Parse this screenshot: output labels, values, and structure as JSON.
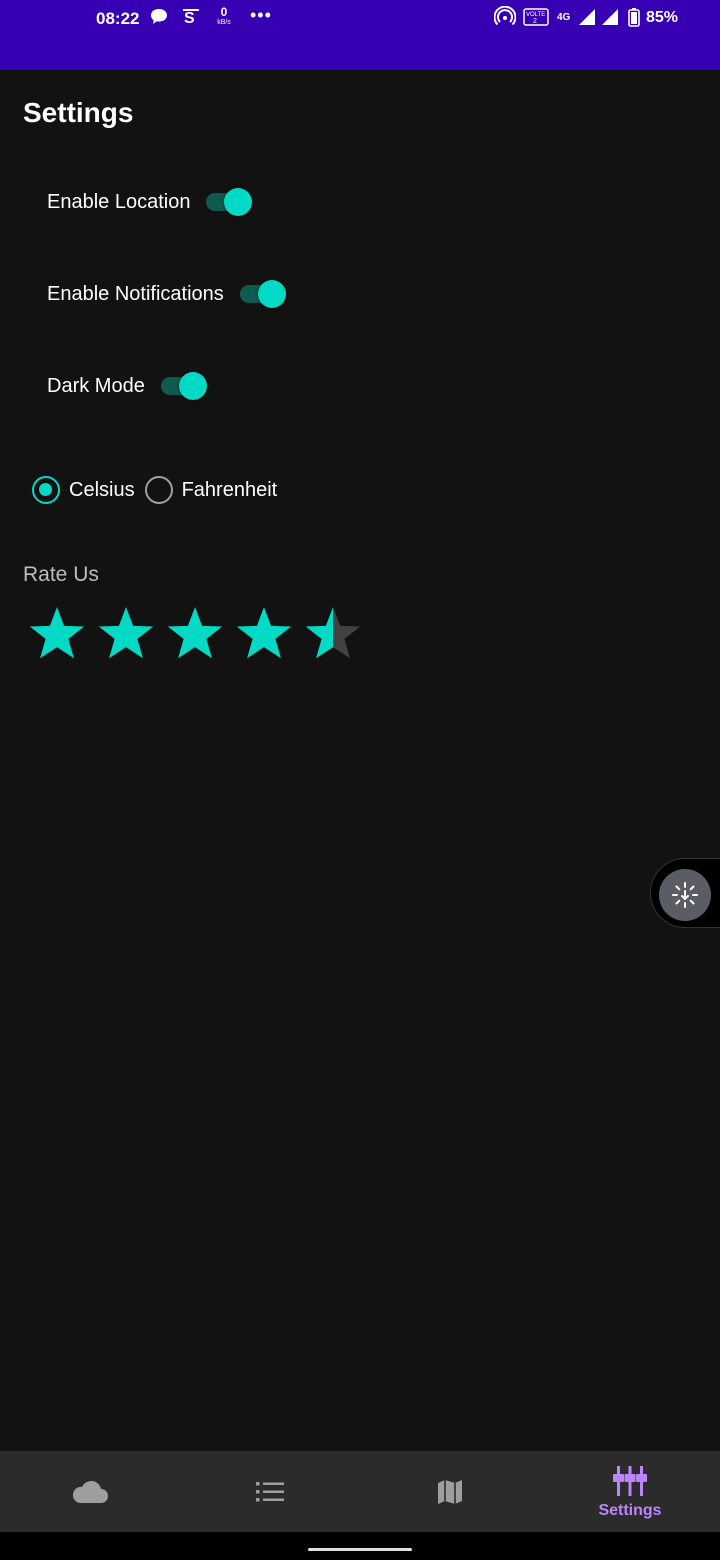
{
  "status_bar": {
    "time": "08:22",
    "data_speed_value": "0",
    "data_speed_unit": "kB/s",
    "more_dots": "•••",
    "network_type": "4G",
    "battery_percent": "85%",
    "volte_label": "VOLTE"
  },
  "page": {
    "title": "Settings"
  },
  "toggles": [
    {
      "label": "Enable Location",
      "checked": true
    },
    {
      "label": "Enable Notifications",
      "checked": true
    },
    {
      "label": "Dark Mode",
      "checked": true
    }
  ],
  "temperature_units": {
    "options": [
      "Celsius",
      "Fahrenheit"
    ],
    "selected": "Celsius"
  },
  "rating": {
    "label": "Rate Us",
    "value": 4.5,
    "max": 5
  },
  "bottom_nav": {
    "items": [
      {
        "icon": "cloud-icon",
        "label": ""
      },
      {
        "icon": "list-icon",
        "label": ""
      },
      {
        "icon": "map-icon",
        "label": ""
      },
      {
        "icon": "settings-sliders-icon",
        "label": "Settings"
      }
    ],
    "active_index": 3
  },
  "colors": {
    "status_bar": "#3700b3",
    "accent": "#03dac5",
    "background": "#121212",
    "nav_active": "#bb86fc",
    "nav_inactive": "#9e9e9e"
  }
}
